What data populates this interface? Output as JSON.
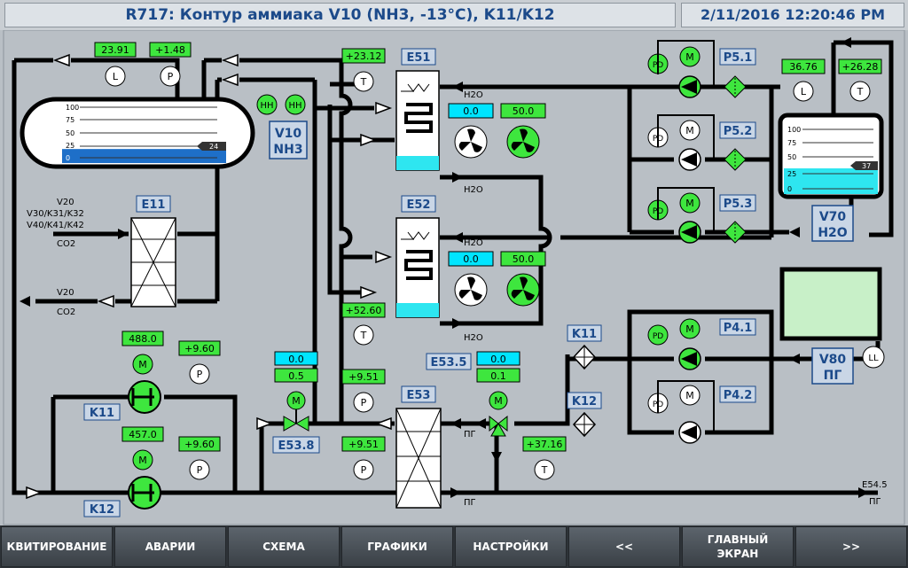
{
  "header": {
    "title": "R717: Контур аммиака V10 (NH3, -13°C), K11/K12",
    "datetime": "2/11/2016 12:20:46 PM"
  },
  "tanks": {
    "V10": {
      "label_top": "V10",
      "label_bottom": "NH3",
      "level_display": "24",
      "level_fraction": 0.24,
      "scale": [
        "100",
        "75",
        "50",
        "25",
        "0"
      ],
      "alarm_labels": [
        "HH",
        "HH"
      ]
    },
    "V70": {
      "label_top": "V70",
      "label_bottom": "H2O",
      "level_display": "37",
      "level_fraction": 0.37,
      "scale": [
        "100",
        "75",
        "50",
        "25",
        "0"
      ]
    },
    "V80": {
      "label_top": "V80",
      "label_bottom": "ПГ"
    }
  },
  "sensors": {
    "v10_level": {
      "value": "23.91",
      "symbol": "L"
    },
    "v10_pressure": {
      "value": "+1.48",
      "symbol": "P"
    },
    "e51_temp": {
      "value": "+23.12",
      "symbol": "T"
    },
    "v70_level": {
      "value": "36.76",
      "symbol": "L"
    },
    "v70_temp": {
      "value": "+26.28",
      "symbol": "T"
    },
    "e52_temp": {
      "value": "+52.60",
      "symbol": "T"
    },
    "k11_motor": {
      "value": "488.0",
      "symbol": "M"
    },
    "k11_pressure": {
      "value": "+9.60",
      "symbol": "P"
    },
    "k12_motor": {
      "value": "457.0",
      "symbol": "M"
    },
    "k12_pressure": {
      "value": "+9.60",
      "symbol": "P"
    },
    "e538_valve": {
      "value_top": "0.0",
      "value_bottom": "0.5",
      "symbol": "M"
    },
    "e53_pressure_top": {
      "value": "+9.51",
      "symbol": "P"
    },
    "e53_pressure_bottom": {
      "value": "+9.51",
      "symbol": "P"
    },
    "e535_valve": {
      "value_top": "0.0",
      "value_bottom": "0.1",
      "symbol": "M"
    },
    "e53_temp": {
      "value": "+37.16",
      "symbol": "T"
    },
    "v80_level": {
      "symbol": "LL"
    }
  },
  "exchangers": {
    "E51": {
      "label": "E51",
      "fan_top": "0.0",
      "fan_bottom": "50.0",
      "water": "H2O",
      "water_out": "H2O"
    },
    "E52": {
      "label": "E52",
      "fan_top": "0.0",
      "fan_bottom": "50.0",
      "water": "H2O",
      "water_out": "H2O"
    },
    "E11": {
      "label": "E11"
    },
    "E53": {
      "label": "E53"
    }
  },
  "pumps": {
    "P51": {
      "label": "P5.1"
    },
    "P52": {
      "label": "P5.2"
    },
    "P53": {
      "label": "P5.3"
    },
    "P41": {
      "label": "P4.1"
    },
    "P42": {
      "label": "P4.2"
    },
    "K11": {
      "label": "K11"
    },
    "K12": {
      "label": "K12"
    }
  },
  "pump_symbols": {
    "pd": "PD",
    "m": "M"
  },
  "valves": {
    "E538": {
      "label": "E53.8"
    },
    "E535": {
      "label": "E53.5"
    },
    "K11v": {
      "label": "K11"
    },
    "K12v": {
      "label": "K12"
    }
  },
  "flows": {
    "e11_in_1": "V20",
    "e11_in_2": "V30/K31/K32",
    "e11_in_3": "V40/K41/K42",
    "e11_in_4": "CO2",
    "e11_out_1": "V20",
    "e11_out_2": "CO2",
    "pg_1": "ПГ",
    "pg_2": "ПГ",
    "e545": "E54.5",
    "e545_sub": "ПГ"
  },
  "colors": {
    "accent": "#1c4a8a",
    "green_value": "#3ee63e",
    "cyan_value": "#00e5ff",
    "tank_fill": "#1e6fc8",
    "water_fill": "#2ee6f0",
    "pipe": "#000000",
    "background": "#b9bfc5"
  },
  "nav": [
    "КВИТИРОВАНИЕ",
    "АВАРИИ",
    "СХЕМА",
    "ГРАФИКИ",
    "НАСТРОЙКИ",
    "<<",
    "ГЛАВНЫЙ\nЭКРАН",
    ">>"
  ]
}
